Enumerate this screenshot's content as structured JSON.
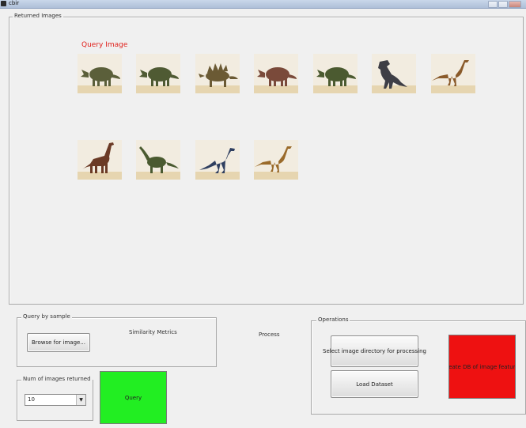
{
  "window": {
    "title": "cbir"
  },
  "returned_images": {
    "legend": "Returned Images",
    "query_label": "Query Image",
    "thumbnails": [
      {
        "icon": "triceratops-icon",
        "color": "#5b5f3a"
      },
      {
        "icon": "triceratops-icon",
        "color": "#4f5a33"
      },
      {
        "icon": "stegosaurus-icon",
        "color": "#6b5a34"
      },
      {
        "icon": "triceratops-icon",
        "color": "#7a4a3a"
      },
      {
        "icon": "triceratops-icon",
        "color": "#4b5a30"
      },
      {
        "icon": "tyrannosaurus-icon",
        "color": "#3e3e46"
      },
      {
        "icon": "ornithomimus-icon",
        "color": "#8a5a2a"
      },
      {
        "icon": "brachiosaurus-icon",
        "color": "#6b3a25"
      },
      {
        "icon": "diplodocus-icon",
        "color": "#4a5a30"
      },
      {
        "icon": "compsognathus-icon",
        "color": "#2f3f60"
      },
      {
        "icon": "ornithomimus-icon",
        "color": "#9a6a2a"
      }
    ]
  },
  "query_by_sample": {
    "legend": "Query by sample",
    "browse_label": "Browse for image...",
    "similarity_label": "Similarity Metrics"
  },
  "process_label": "Process",
  "num_images": {
    "legend": "Num of images returned",
    "selected": "10"
  },
  "query_button": {
    "label": "Query",
    "color": "#22ee22"
  },
  "operations": {
    "legend": "Operations",
    "select_dir_label": "Select image directory for processing",
    "load_dataset_label": "Load Dataset",
    "create_db_label": "Create DB of image features",
    "create_db_color": "#ee1111"
  }
}
